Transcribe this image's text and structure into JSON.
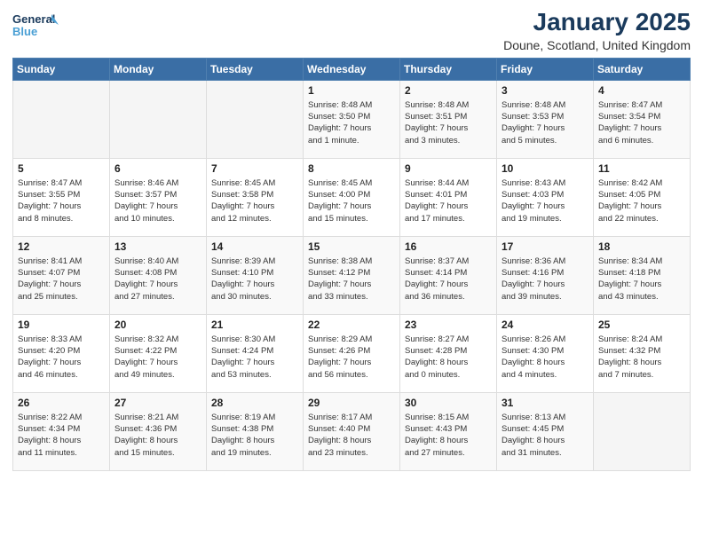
{
  "logo": {
    "line1": "General",
    "line2": "Blue"
  },
  "title": "January 2025",
  "subtitle": "Doune, Scotland, United Kingdom",
  "weekdays": [
    "Sunday",
    "Monday",
    "Tuesday",
    "Wednesday",
    "Thursday",
    "Friday",
    "Saturday"
  ],
  "weeks": [
    [
      {
        "day": "",
        "content": ""
      },
      {
        "day": "",
        "content": ""
      },
      {
        "day": "",
        "content": ""
      },
      {
        "day": "1",
        "content": "Sunrise: 8:48 AM\nSunset: 3:50 PM\nDaylight: 7 hours\nand 1 minute."
      },
      {
        "day": "2",
        "content": "Sunrise: 8:48 AM\nSunset: 3:51 PM\nDaylight: 7 hours\nand 3 minutes."
      },
      {
        "day": "3",
        "content": "Sunrise: 8:48 AM\nSunset: 3:53 PM\nDaylight: 7 hours\nand 5 minutes."
      },
      {
        "day": "4",
        "content": "Sunrise: 8:47 AM\nSunset: 3:54 PM\nDaylight: 7 hours\nand 6 minutes."
      }
    ],
    [
      {
        "day": "5",
        "content": "Sunrise: 8:47 AM\nSunset: 3:55 PM\nDaylight: 7 hours\nand 8 minutes."
      },
      {
        "day": "6",
        "content": "Sunrise: 8:46 AM\nSunset: 3:57 PM\nDaylight: 7 hours\nand 10 minutes."
      },
      {
        "day": "7",
        "content": "Sunrise: 8:45 AM\nSunset: 3:58 PM\nDaylight: 7 hours\nand 12 minutes."
      },
      {
        "day": "8",
        "content": "Sunrise: 8:45 AM\nSunset: 4:00 PM\nDaylight: 7 hours\nand 15 minutes."
      },
      {
        "day": "9",
        "content": "Sunrise: 8:44 AM\nSunset: 4:01 PM\nDaylight: 7 hours\nand 17 minutes."
      },
      {
        "day": "10",
        "content": "Sunrise: 8:43 AM\nSunset: 4:03 PM\nDaylight: 7 hours\nand 19 minutes."
      },
      {
        "day": "11",
        "content": "Sunrise: 8:42 AM\nSunset: 4:05 PM\nDaylight: 7 hours\nand 22 minutes."
      }
    ],
    [
      {
        "day": "12",
        "content": "Sunrise: 8:41 AM\nSunset: 4:07 PM\nDaylight: 7 hours\nand 25 minutes."
      },
      {
        "day": "13",
        "content": "Sunrise: 8:40 AM\nSunset: 4:08 PM\nDaylight: 7 hours\nand 27 minutes."
      },
      {
        "day": "14",
        "content": "Sunrise: 8:39 AM\nSunset: 4:10 PM\nDaylight: 7 hours\nand 30 minutes."
      },
      {
        "day": "15",
        "content": "Sunrise: 8:38 AM\nSunset: 4:12 PM\nDaylight: 7 hours\nand 33 minutes."
      },
      {
        "day": "16",
        "content": "Sunrise: 8:37 AM\nSunset: 4:14 PM\nDaylight: 7 hours\nand 36 minutes."
      },
      {
        "day": "17",
        "content": "Sunrise: 8:36 AM\nSunset: 4:16 PM\nDaylight: 7 hours\nand 39 minutes."
      },
      {
        "day": "18",
        "content": "Sunrise: 8:34 AM\nSunset: 4:18 PM\nDaylight: 7 hours\nand 43 minutes."
      }
    ],
    [
      {
        "day": "19",
        "content": "Sunrise: 8:33 AM\nSunset: 4:20 PM\nDaylight: 7 hours\nand 46 minutes."
      },
      {
        "day": "20",
        "content": "Sunrise: 8:32 AM\nSunset: 4:22 PM\nDaylight: 7 hours\nand 49 minutes."
      },
      {
        "day": "21",
        "content": "Sunrise: 8:30 AM\nSunset: 4:24 PM\nDaylight: 7 hours\nand 53 minutes."
      },
      {
        "day": "22",
        "content": "Sunrise: 8:29 AM\nSunset: 4:26 PM\nDaylight: 7 hours\nand 56 minutes."
      },
      {
        "day": "23",
        "content": "Sunrise: 8:27 AM\nSunset: 4:28 PM\nDaylight: 8 hours\nand 0 minutes."
      },
      {
        "day": "24",
        "content": "Sunrise: 8:26 AM\nSunset: 4:30 PM\nDaylight: 8 hours\nand 4 minutes."
      },
      {
        "day": "25",
        "content": "Sunrise: 8:24 AM\nSunset: 4:32 PM\nDaylight: 8 hours\nand 7 minutes."
      }
    ],
    [
      {
        "day": "26",
        "content": "Sunrise: 8:22 AM\nSunset: 4:34 PM\nDaylight: 8 hours\nand 11 minutes."
      },
      {
        "day": "27",
        "content": "Sunrise: 8:21 AM\nSunset: 4:36 PM\nDaylight: 8 hours\nand 15 minutes."
      },
      {
        "day": "28",
        "content": "Sunrise: 8:19 AM\nSunset: 4:38 PM\nDaylight: 8 hours\nand 19 minutes."
      },
      {
        "day": "29",
        "content": "Sunrise: 8:17 AM\nSunset: 4:40 PM\nDaylight: 8 hours\nand 23 minutes."
      },
      {
        "day": "30",
        "content": "Sunrise: 8:15 AM\nSunset: 4:43 PM\nDaylight: 8 hours\nand 27 minutes."
      },
      {
        "day": "31",
        "content": "Sunrise: 8:13 AM\nSunset: 4:45 PM\nDaylight: 8 hours\nand 31 minutes."
      },
      {
        "day": "",
        "content": ""
      }
    ]
  ]
}
